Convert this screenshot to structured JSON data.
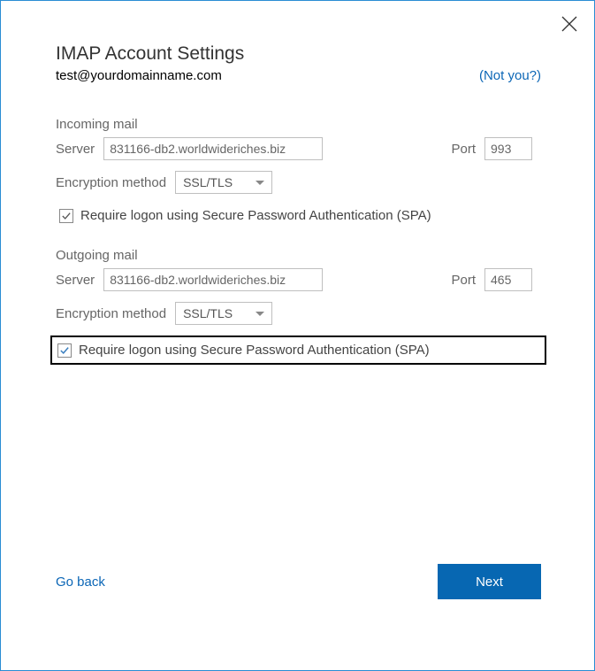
{
  "title": "IMAP Account Settings",
  "email": "test@yourdomainname.com",
  "not_you": "(Not you?)",
  "incoming": {
    "header": "Incoming mail",
    "server_label": "Server",
    "server_value": "831166-db2.worldwideriches.biz",
    "port_label": "Port",
    "port_value": "993",
    "encryption_label": "Encryption method",
    "encryption_value": "SSL/TLS",
    "spa_label": "Require logon using Secure Password Authentication (SPA)"
  },
  "outgoing": {
    "header": "Outgoing mail",
    "server_label": "Server",
    "server_value": "831166-db2.worldwideriches.biz",
    "port_label": "Port",
    "port_value": "465",
    "encryption_label": "Encryption method",
    "encryption_value": "SSL/TLS",
    "spa_label": "Require logon using Secure Password Authentication (SPA)"
  },
  "go_back": "Go back",
  "next": "Next"
}
